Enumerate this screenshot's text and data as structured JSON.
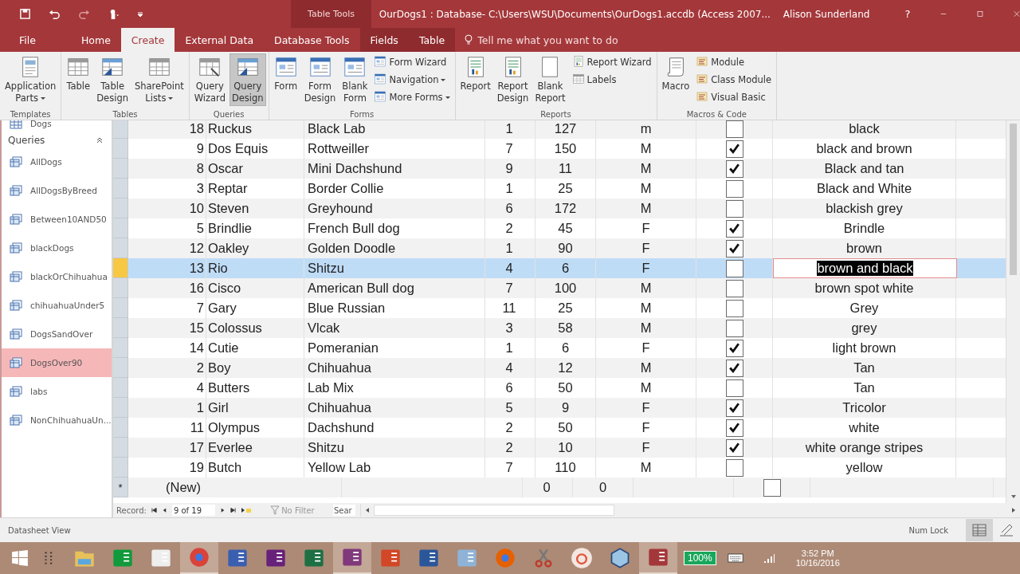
{
  "title_bar": {
    "context_label": "Table Tools",
    "title": "OurDogs1 : Database- C:\\Users\\WSU\\Documents\\OurDogs1.accdb (Access 2007...",
    "user": "Alison Sunderland",
    "help": "?"
  },
  "ribbon_tabs": [
    {
      "label": "File",
      "selected": false,
      "kind": "file"
    },
    {
      "label": "Home",
      "selected": false,
      "kind": "normal"
    },
    {
      "label": "Create",
      "selected": true,
      "kind": "normal"
    },
    {
      "label": "External Data",
      "selected": false,
      "kind": "normal"
    },
    {
      "label": "Database Tools",
      "selected": false,
      "kind": "normal"
    },
    {
      "label": "Fields",
      "selected": false,
      "kind": "context"
    },
    {
      "label": "Table",
      "selected": false,
      "kind": "context"
    }
  ],
  "tell_me": {
    "placeholder": "Tell me what you want to do"
  },
  "ribbon_groups": [
    {
      "label": "Templates",
      "columns": [
        [
          {
            "label": "Application Parts",
            "kind": "parts",
            "dropdown": true,
            "selected": false
          }
        ]
      ]
    },
    {
      "label": "Tables",
      "columns": [
        [
          {
            "label": "Table",
            "kind": "table",
            "dropdown": false,
            "selected": false
          }
        ],
        [
          {
            "label": "Table Design",
            "kind": "design",
            "dropdown": false,
            "selected": false
          }
        ],
        [
          {
            "label": "SharePoint Lists",
            "kind": "table",
            "dropdown": true,
            "selected": false
          }
        ]
      ]
    },
    {
      "label": "Queries",
      "columns": [
        [
          {
            "label": "Query Wizard",
            "kind": "query",
            "dropdown": false,
            "selected": false
          }
        ],
        [
          {
            "label": "Query Design",
            "kind": "design",
            "dropdown": false,
            "selected": true
          }
        ]
      ]
    },
    {
      "label": "Forms",
      "columns": [
        [
          {
            "label": "Form",
            "kind": "form",
            "dropdown": false,
            "selected": false
          }
        ],
        [
          {
            "label": "Form Design",
            "kind": "form",
            "dropdown": false,
            "selected": false
          }
        ],
        [
          {
            "label": "Blank Form",
            "kind": "form",
            "dropdown": false,
            "selected": false
          }
        ],
        [
          {
            "label": "Form Wizard",
            "kind": "form",
            "dropdown": false,
            "selected": false
          },
          {
            "label": "Navigation",
            "kind": "form",
            "dropdown": true,
            "selected": false
          },
          {
            "label": "More Forms",
            "kind": "form",
            "dropdown": true,
            "selected": false
          }
        ]
      ]
    },
    {
      "label": "Reports",
      "columns": [
        [
          {
            "label": "Report",
            "kind": "report",
            "dropdown": false,
            "selected": false
          }
        ],
        [
          {
            "label": "Report Design",
            "kind": "report",
            "dropdown": false,
            "selected": false
          }
        ],
        [
          {
            "label": "Blank Report",
            "kind": "page",
            "dropdown": false,
            "selected": false
          }
        ],
        [
          {
            "label": "Report Wizard",
            "kind": "report",
            "dropdown": false,
            "selected": false
          },
          {
            "label": "Labels",
            "kind": "table",
            "dropdown": false,
            "selected": false
          }
        ]
      ]
    },
    {
      "label": "Macros & Code",
      "columns": [
        [
          {
            "label": "Macro",
            "kind": "scroll",
            "dropdown": false,
            "selected": false
          }
        ],
        [
          {
            "label": "Module",
            "kind": "module",
            "dropdown": false,
            "selected": false
          },
          {
            "label": "Class Module",
            "kind": "module",
            "dropdown": false,
            "selected": false
          },
          {
            "label": "Visual Basic",
            "kind": "module",
            "dropdown": false,
            "selected": false
          }
        ]
      ]
    }
  ],
  "sidebar": {
    "items": [
      {
        "label": "Dogs",
        "kind": "table",
        "selected": false
      }
    ],
    "section": "Queries",
    "expanded": true,
    "queries": [
      {
        "label": "AllDogs",
        "selected": false
      },
      {
        "label": "AllDogsByBreed",
        "selected": false
      },
      {
        "label": "Between10AND50",
        "selected": false
      },
      {
        "label": "blackDogs",
        "selected": false
      },
      {
        "label": "blackOrChihuahua",
        "selected": false
      },
      {
        "label": "chihuahuaUnder5",
        "selected": false
      },
      {
        "label": "DogsSandOver",
        "selected": false
      },
      {
        "label": "DogsOver90",
        "selected": true
      },
      {
        "label": "labs",
        "selected": false
      },
      {
        "label": "NonChihuahuaUn...",
        "selected": false
      }
    ]
  },
  "table": {
    "rows": [
      {
        "cells": [
          "18",
          "Ruckus",
          "Black Lab",
          "1",
          "127",
          "m",
          "black"
        ],
        "checked": false,
        "selected": false
      },
      {
        "cells": [
          "9",
          "Dos Equis",
          "Rottweiller",
          "7",
          "150",
          "M",
          "black and brown"
        ],
        "checked": true,
        "selected": false
      },
      {
        "cells": [
          "8",
          "Oscar",
          "Mini Dachshund",
          "9",
          "11",
          "M",
          "Black and tan"
        ],
        "checked": true,
        "selected": false
      },
      {
        "cells": [
          "3",
          "Reptar",
          "Border Collie",
          "1",
          "25",
          "M",
          "Black and White"
        ],
        "checked": false,
        "selected": false
      },
      {
        "cells": [
          "10",
          "Steven",
          "Greyhound",
          "6",
          "172",
          "M",
          "blackish grey"
        ],
        "checked": false,
        "selected": false
      },
      {
        "cells": [
          "5",
          "Brindlie",
          "French Bull dog",
          "2",
          "45",
          "F",
          "Brindle"
        ],
        "checked": true,
        "selected": false
      },
      {
        "cells": [
          "12",
          "Oakley",
          "Golden Doodle",
          "1",
          "90",
          "F",
          "brown"
        ],
        "checked": true,
        "selected": false
      },
      {
        "cells": [
          "13",
          "Rio",
          "Shitzu",
          "4",
          "6",
          "F",
          "brown and black"
        ],
        "checked": false,
        "selected": true
      },
      {
        "cells": [
          "16",
          "Cisco",
          "American Bull dog",
          "7",
          "100",
          "M",
          "brown spot white"
        ],
        "checked": false,
        "selected": false
      },
      {
        "cells": [
          "7",
          "Gary",
          "Blue Russian",
          "11",
          "25",
          "M",
          "Grey"
        ],
        "checked": false,
        "selected": false
      },
      {
        "cells": [
          "15",
          "Colossus",
          "Vlcak",
          "3",
          "58",
          "M",
          "grey"
        ],
        "checked": false,
        "selected": false
      },
      {
        "cells": [
          "14",
          "Cutie",
          "Pomeranian",
          "1",
          "6",
          "F",
          "light brown"
        ],
        "checked": true,
        "selected": false
      },
      {
        "cells": [
          "2",
          "Boy",
          "Chihuahua",
          "4",
          "12",
          "M",
          "Tan"
        ],
        "checked": true,
        "selected": false
      },
      {
        "cells": [
          "4",
          "Butters",
          "Lab Mix",
          "6",
          "50",
          "M",
          "Tan"
        ],
        "checked": false,
        "selected": false
      },
      {
        "cells": [
          "1",
          "Girl",
          "Chihuahua",
          "5",
          "9",
          "F",
          "Tricolor"
        ],
        "checked": true,
        "selected": false
      },
      {
        "cells": [
          "11",
          "Olympus",
          "Dachshund",
          "2",
          "50",
          "F",
          "white"
        ],
        "checked": true,
        "selected": false
      },
      {
        "cells": [
          "17",
          "Everlee",
          "Shitzu",
          "2",
          "10",
          "F",
          "white orange stripes"
        ],
        "checked": true,
        "selected": false
      },
      {
        "cells": [
          "19",
          "Butch",
          "Yellow Lab",
          "7",
          "110",
          "M",
          "yellow"
        ],
        "checked": false,
        "selected": false
      }
    ],
    "new_row": {
      "marker": "*",
      "cells": [
        "(New)",
        "0",
        "0"
      ],
      "checked": false
    }
  },
  "record_nav": {
    "label": "Record:",
    "position": "9 of 19",
    "filter": "No Filter",
    "search": "Sear"
  },
  "status_bar": {
    "view": "Datasheet View",
    "num_lock": "Num Lock"
  },
  "taskbar": {
    "apps": [
      {
        "kind": "folder",
        "active": false
      },
      {
        "kind": "store",
        "active": false
      },
      {
        "kind": "g",
        "active": false
      },
      {
        "kind": "chrome",
        "active": true
      },
      {
        "kind": "visio",
        "active": false
      },
      {
        "kind": "vs",
        "active": false
      },
      {
        "kind": "excel",
        "active": false
      },
      {
        "kind": "onenote",
        "active": true
      },
      {
        "kind": "powerpoint",
        "active": false
      },
      {
        "kind": "word",
        "active": false
      },
      {
        "kind": "calculator",
        "active": false
      },
      {
        "kind": "firefox",
        "active": false
      },
      {
        "kind": "scissors",
        "active": false
      },
      {
        "kind": "ring",
        "active": false
      },
      {
        "kind": "cube",
        "active": false
      },
      {
        "kind": "access",
        "active": true
      }
    ],
    "battery": "100%",
    "time": "3:52 PM",
    "date": "10/16/2016"
  }
}
